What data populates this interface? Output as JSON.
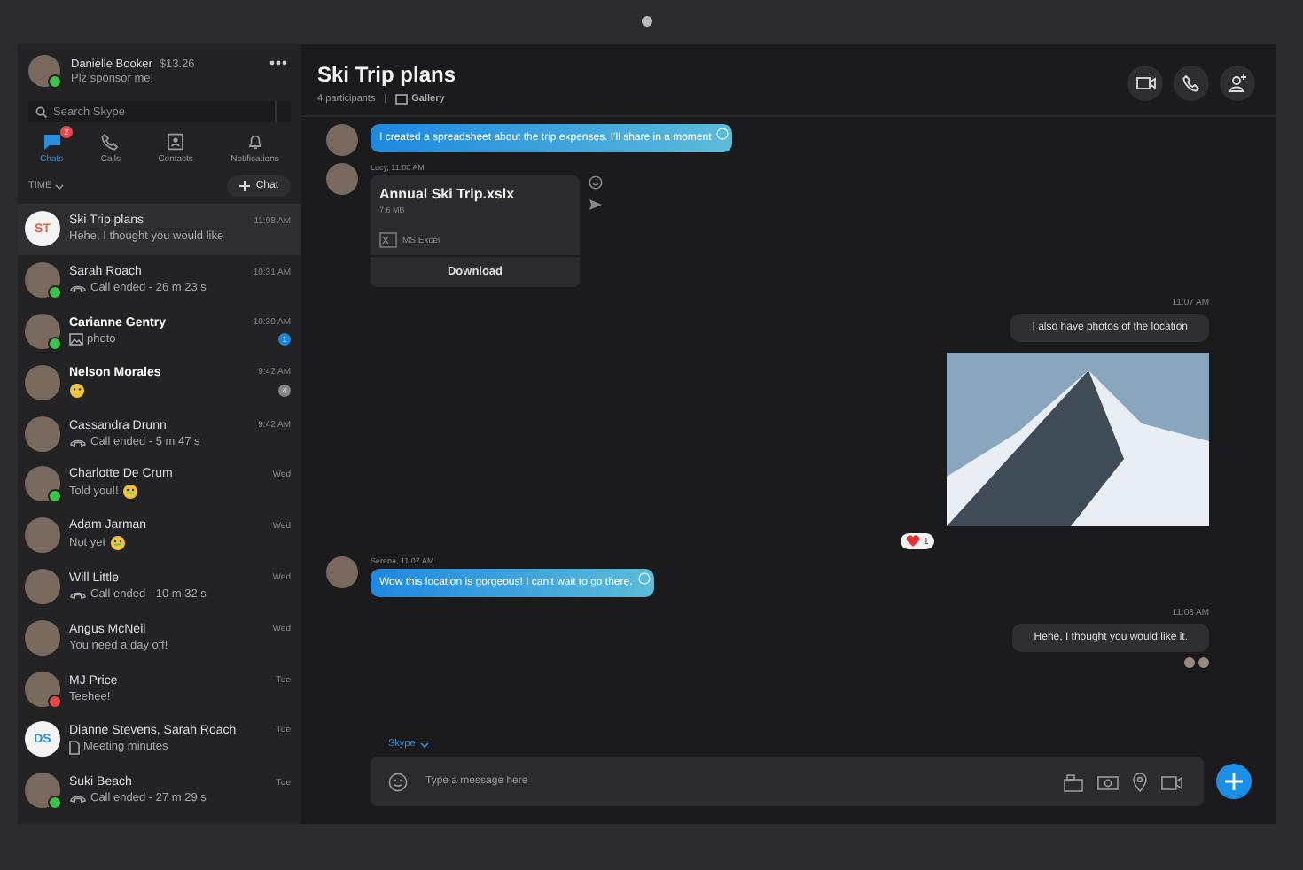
{
  "profile": {
    "name": "Danielle Booker",
    "balance": "$13.26",
    "status": "Plz sponsor me!",
    "color": "#3cc14b"
  },
  "search": {
    "placeholder": "Search Skype"
  },
  "nav": [
    {
      "label": "Chats",
      "kind": "chats",
      "selected": true,
      "badge": "2"
    },
    {
      "label": "Calls",
      "kind": "calls",
      "selected": false
    },
    {
      "label": "Contacts",
      "kind": "contacts",
      "selected": false
    },
    {
      "label": "Notifications",
      "kind": "notifications",
      "selected": false
    }
  ],
  "sort": {
    "label": "TIME"
  },
  "new_chat": {
    "label": "Chat"
  },
  "conversations": [
    {
      "kind": "text",
      "name": "Ski Trip plans",
      "initials": "ST",
      "preview": "Hehe, I thought you would like",
      "time": "11:08 AM",
      "selected": true,
      "unread": false
    },
    {
      "kind": "call",
      "name": "Sarah Roach",
      "preview": "Call ended - 26 m 23 s",
      "time": "10:31 AM",
      "selected": false,
      "unread": false,
      "color": "#3cc14b"
    },
    {
      "kind": "photo",
      "name": "Carianne Gentry",
      "preview": "photo",
      "time": "10:30 AM",
      "selected": false,
      "unread": true,
      "badge": {
        "count": "1",
        "muted": false
      },
      "color": "#3cc14b"
    },
    {
      "kind": "emoji",
      "name": "Nelson Morales",
      "time": "9:42 AM",
      "selected": false,
      "unread": true,
      "badge": {
        "count": "4",
        "muted": true
      }
    },
    {
      "kind": "call",
      "name": "Cassandra Drunn",
      "preview": "Call ended - 5 m 47 s",
      "time": "9:42 AM",
      "selected": false,
      "unread": false
    },
    {
      "kind": "text_emoji",
      "name": "Charlotte De Crum",
      "preview": "Told you!!",
      "time": "Wed",
      "selected": false,
      "unread": false,
      "color": "#3cc14b"
    },
    {
      "kind": "text_emoji",
      "name": "Adam Jarman",
      "preview": "Not yet",
      "time": "Wed",
      "selected": false,
      "unread": false
    },
    {
      "kind": "call",
      "name": "Will Little",
      "preview": "Call ended - 10 m 32 s",
      "time": "Wed",
      "selected": false,
      "unread": false
    },
    {
      "kind": "text",
      "name": "Angus McNeil",
      "preview": "You need a day off!",
      "time": "Wed",
      "selected": false,
      "unread": false
    },
    {
      "kind": "text",
      "name": "MJ Price",
      "preview": "Teehee!",
      "time": "Tue",
      "selected": false,
      "unread": false,
      "color": "#e8474b"
    },
    {
      "kind": "file",
      "name": "Dianne Stevens, Sarah Roach",
      "initials": "DS",
      "preview": "Meeting minutes",
      "time": "Tue",
      "selected": false,
      "unread": false
    },
    {
      "kind": "call",
      "name": "Suki Beach",
      "preview": "Call ended - 27 m 29 s",
      "time": "Tue",
      "selected": false,
      "unread": false,
      "color": "#3cc14b"
    }
  ],
  "chat": {
    "title": "Ski Trip plans",
    "participants": "4 participants",
    "separator": "|",
    "gallery": "Gallery"
  },
  "messages": [
    {
      "kind": "incoming",
      "text": "I created a spreadsheet about the trip expenses. I'll share in a moment"
    },
    {
      "kind": "file",
      "meta": "Lucy, 11:00 AM",
      "file_name": "Annual Ski Trip.xslx",
      "size": "7.6 MB",
      "app": "MS Excel",
      "action": "Download"
    },
    {
      "kind": "outgoing",
      "time": "11:07 AM",
      "text": "I also have photos of the location"
    },
    {
      "kind": "image",
      "reaction_count": "1"
    },
    {
      "kind": "incoming",
      "meta": "Serena, 11:07 AM",
      "text": "Wow this location is gorgeous! I can't wait to go there."
    },
    {
      "kind": "outgoing",
      "time": "11:08 AM",
      "text": "Hehe, I thought you would like it.",
      "read": true
    }
  ],
  "composer": {
    "mode": "Skype",
    "placeholder": "Type a message here"
  }
}
